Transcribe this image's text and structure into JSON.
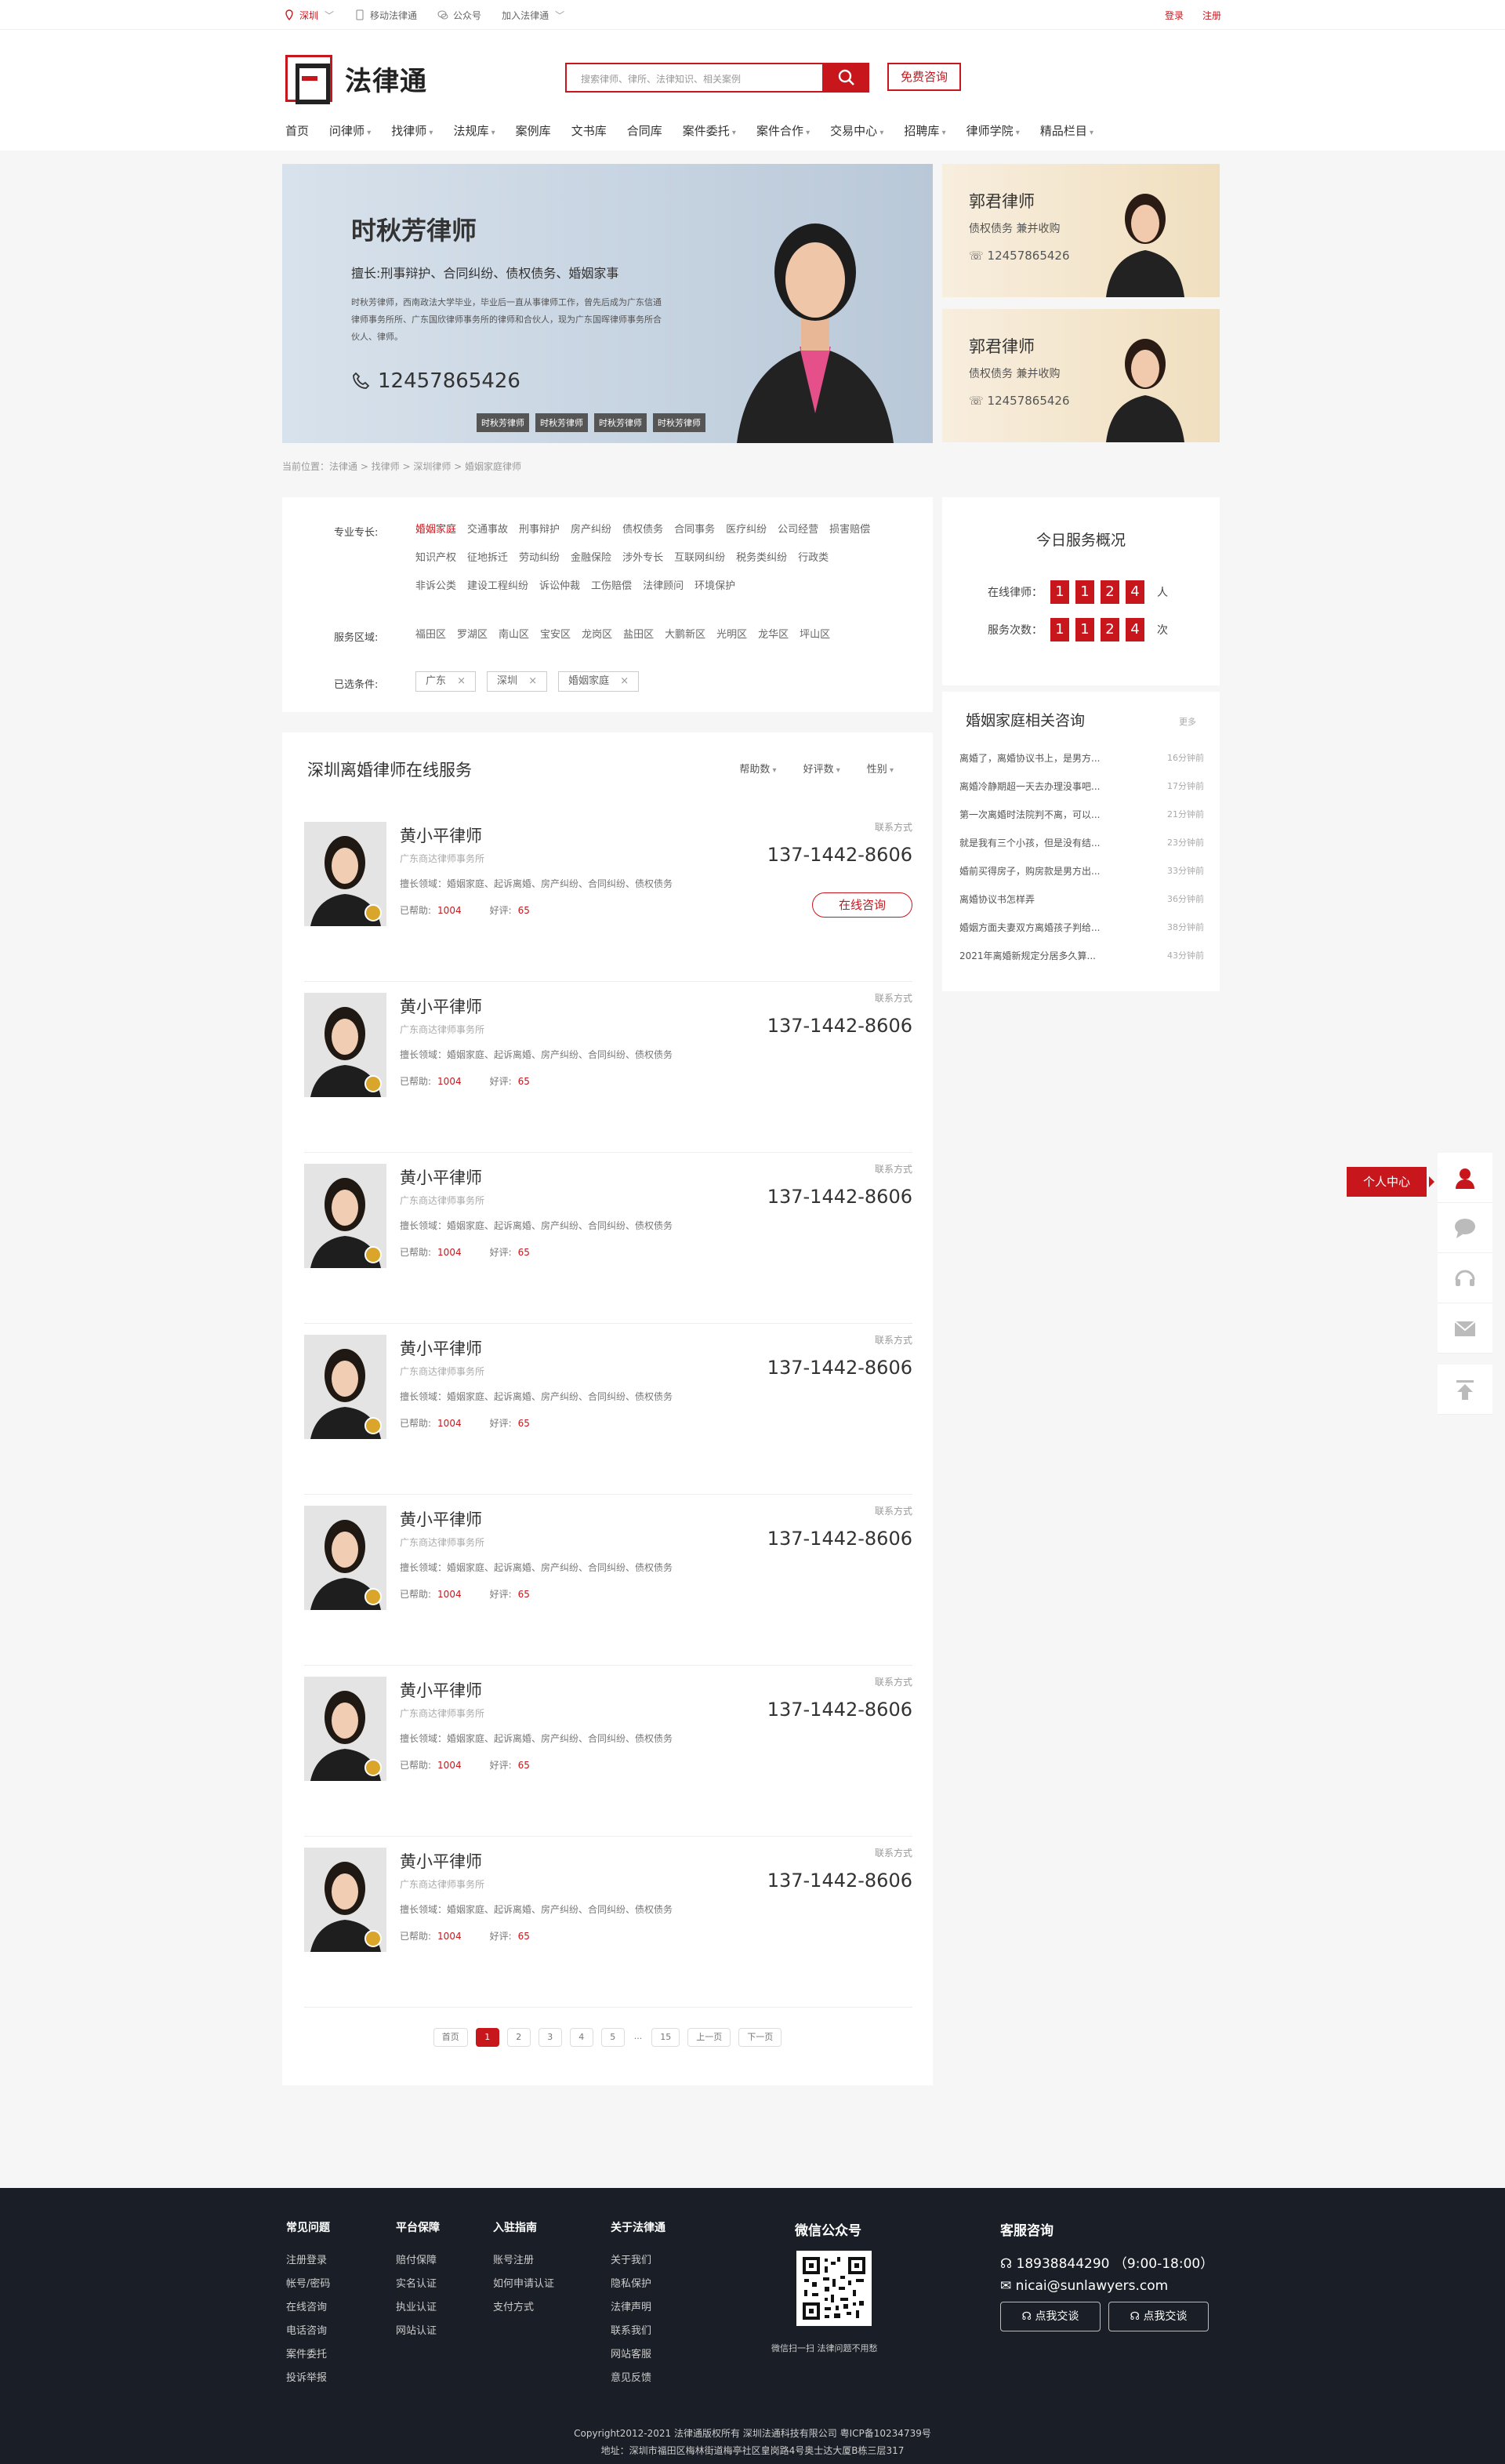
{
  "topbar": {
    "city": "深圳",
    "mobile": "移动法律通",
    "wechat": "公众号",
    "join": "加入法律通",
    "login": "登录",
    "register": "注册"
  },
  "header": {
    "logo": "法律通",
    "search_placeholder": "搜索律师、律所、法律知识、相关案例",
    "consult": "免费咨询"
  },
  "nav": [
    "首页",
    "问律师",
    "找律师",
    "法规库",
    "案例库",
    "文书库",
    "合同库",
    "案件委托",
    "案件合作",
    "交易中心",
    "招聘库",
    "律师学院",
    "精品栏目"
  ],
  "banner": {
    "name": "时秋芳律师",
    "skills": "擅长:刑事辩护、合同纠纷、债权债务、婚姻家事",
    "desc": "时秋芳律师，西南政法大学毕业，毕业后一直从事律师工作，曾先后成为广东信通律师事务所所、广东国欣律师事务所的律师和合伙人，现为广东国晖律师事务所合伙人、律师。",
    "phone": "12457865426",
    "tags": [
      "时秋芳律师",
      "时秋芳律师",
      "时秋芳律师",
      "时秋芳律师"
    ]
  },
  "side_cards": [
    {
      "name": "郭君律师",
      "tags": "债权债务  兼并收购",
      "phone": "12457865426"
    },
    {
      "name": "郭君律师",
      "tags": "债权债务  兼并收购",
      "phone": "12457865426"
    }
  ],
  "breadcrumb": "当前位置：法律通 > 找律师 > 深圳律师 > 婚姻家庭律师",
  "filter": {
    "spec_label": "专业专长:",
    "specs": [
      "婚姻家庭",
      "交通事故",
      "刑事辩护",
      "房产纠纷",
      "债权债务",
      "合同事务",
      "医疗纠纷",
      "公司经营",
      "损害赔偿",
      "知识产权",
      "征地拆迁",
      "劳动纠纷",
      "金融保险",
      "涉外专长",
      "互联网纠纷",
      "税务类纠纷",
      "行政类",
      "非诉公类",
      "建设工程纠纷",
      "诉讼仲裁",
      "工伤赔偿",
      "法律顾问",
      "环境保护"
    ],
    "area_label": "服务区域:",
    "areas": [
      "福田区",
      "罗湖区",
      "南山区",
      "宝安区",
      "龙岗区",
      "盐田区",
      "大鹏新区",
      "光明区",
      "龙华区",
      "坪山区"
    ],
    "sel_label": "已选条件:",
    "selected": [
      "广东",
      "深圳",
      "婚姻家庭"
    ]
  },
  "list": {
    "title": "深圳离婚律师在线服务",
    "sorts": [
      "帮助数",
      "好评数",
      "性别"
    ]
  },
  "lawyer": {
    "name": "黄小平律师",
    "firm": "广东商达律师事务所",
    "area": "擅长领域：婚姻家庭、起诉离婚、房产纠纷、合同纠纷、债权债务",
    "help_label": "已帮助:",
    "help": "1004",
    "rate_label": "好评:",
    "rate": "65",
    "contact": "联系方式",
    "phone": "137-1442-8606",
    "chat": "在线咨询"
  },
  "pager": {
    "first": "首页",
    "pages": [
      "1",
      "2",
      "3",
      "4",
      "5"
    ],
    "dots": "...",
    "last_page": "15",
    "prev": "上一页",
    "next": "下一页"
  },
  "today": {
    "title": "今日服务概况",
    "online_label": "在线律师：",
    "online": [
      "1",
      "1",
      "2",
      "4"
    ],
    "online_unit": "人",
    "service_label": "服务次数：",
    "service": [
      "1",
      "1",
      "2",
      "4"
    ],
    "service_unit": "次"
  },
  "related": {
    "title": "婚姻家庭相关咨询",
    "more": "更多",
    "items": [
      {
        "q": "离婚了，离婚协议书上，是男方...",
        "t": "16分钟前"
      },
      {
        "q": "离婚冷静期超一天去办理没事吧...",
        "t": "17分钟前"
      },
      {
        "q": "第一次离婚时法院判不离，可以...",
        "t": "21分钟前"
      },
      {
        "q": "就是我有三个小孩，但是没有结...",
        "t": "23分钟前"
      },
      {
        "q": "婚前买得房子，购房款是男方出...",
        "t": "33分钟前"
      },
      {
        "q": "离婚协议书怎样弄",
        "t": "36分钟前"
      },
      {
        "q": "婚姻方面夫妻双方离婚孩子判给...",
        "t": "38分钟前"
      },
      {
        "q": "2021年离婚新规定分居多久算...",
        "t": "43分钟前"
      }
    ]
  },
  "float": {
    "ucenter": "个人中心"
  },
  "footer": {
    "cols": [
      {
        "h": "常见问题",
        "items": [
          "注册登录",
          "帐号/密码",
          "在线咨询",
          "电话咨询",
          "案件委托",
          "投诉举报"
        ]
      },
      {
        "h": "平台保障",
        "items": [
          "赔付保障",
          "实名认证",
          "执业认证",
          "网站认证"
        ]
      },
      {
        "h": "入驻指南",
        "items": [
          "账号注册",
          "如何申请认证",
          "支付方式"
        ]
      },
      {
        "h": "关于法律通",
        "items": [
          "关于我们",
          "隐私保护",
          "法律声明",
          "联系我们",
          "网站客服",
          "意见反馈"
        ]
      }
    ],
    "wechat_title": "微信公众号",
    "wechat_tip": "微信扫一扫  法律问题不用愁",
    "service_title": "客服咨询",
    "service_phone": "18938844290  （9:00-18:00）",
    "service_email": "nicai@sunlawyers.com",
    "btn1": "点我交谈",
    "btn2": "点我交谈",
    "copyright": "Copyright2012-2021 法律通版权所有 深圳法通科技有限公司  粤ICP备10234739号",
    "address": "地址：深圳市福田区梅林街道梅亭社区皇岗路4号奥士达大厦B栋三层317"
  },
  "colors": {
    "accent": "#c8161d",
    "footer_bg": "#1a1e26"
  }
}
